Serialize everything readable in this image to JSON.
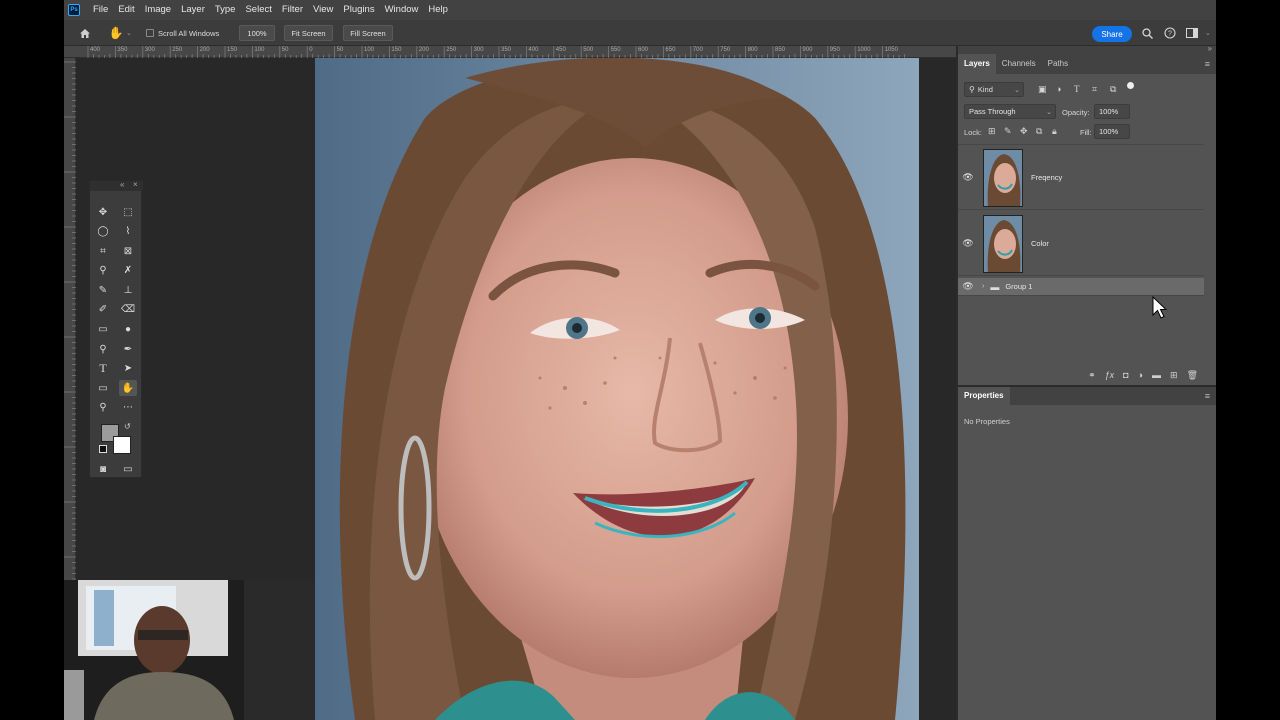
{
  "app": {
    "logo_text": "Ps"
  },
  "menu": [
    "File",
    "Edit",
    "Image",
    "Layer",
    "Type",
    "Select",
    "Filter",
    "View",
    "Plugins",
    "Window",
    "Help"
  ],
  "options_bar": {
    "scroll_all_windows": "Scroll All Windows",
    "zoom": "100%",
    "fit_screen": "Fit Screen",
    "fill_screen": "Fill Screen",
    "share": "Share"
  },
  "ruler_top_labels": [
    "400",
    "350",
    "300",
    "250",
    "200",
    "150",
    "100",
    "50",
    "0",
    "50",
    "100",
    "150",
    "200",
    "250",
    "300",
    "350",
    "400",
    "450",
    "500",
    "550",
    "600",
    "650",
    "700",
    "750",
    "800",
    "850",
    "900",
    "950",
    "1000",
    "1050"
  ],
  "layers_panel": {
    "tabs": [
      "Layers",
      "Channels",
      "Paths"
    ],
    "filter_kind": "Kind",
    "blend_mode": "Pass Through",
    "opacity_label": "Opacity:",
    "opacity_value": "100%",
    "lock_label": "Lock:",
    "fill_label": "Fill:",
    "fill_value": "100%",
    "layers": [
      {
        "name": "Freqency",
        "type": "pixel"
      },
      {
        "name": "Color",
        "type": "pixel"
      },
      {
        "name": "Group 1",
        "type": "group"
      }
    ]
  },
  "properties_panel": {
    "title": "Properties",
    "empty_text": "No Properties"
  },
  "colors": {
    "app_bg": "#535353",
    "menubar": "#424242",
    "accent_blue": "#1473e6",
    "canvas_bg": "#282828"
  }
}
